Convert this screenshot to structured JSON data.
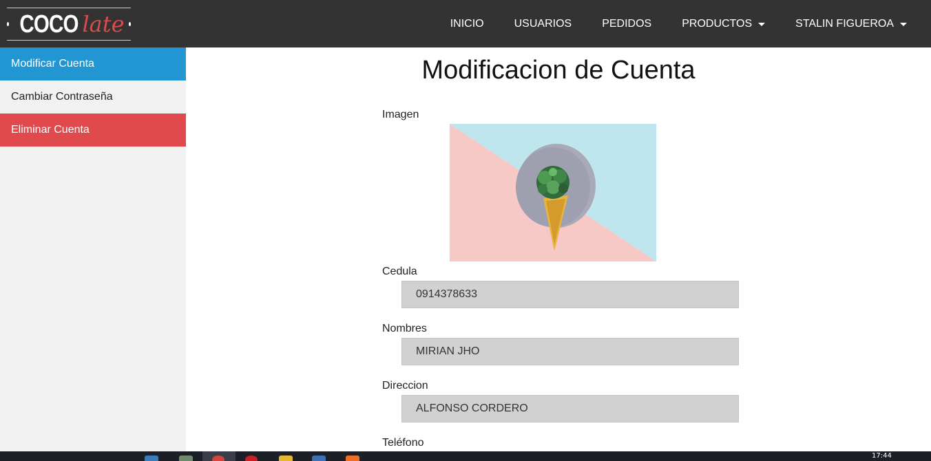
{
  "brand": {
    "part1": "COCO",
    "part2": "late"
  },
  "nav": {
    "links": [
      {
        "label": "INICIO"
      },
      {
        "label": "USUARIOS"
      },
      {
        "label": "PEDIDOS"
      },
      {
        "label": "PRODUCTOS"
      },
      {
        "label": "STALIN FIGUEROA"
      }
    ]
  },
  "sidebar": {
    "items": [
      {
        "label": "Modificar Cuenta"
      },
      {
        "label": "Cambiar Contraseña"
      },
      {
        "label": "Eliminar Cuenta"
      }
    ]
  },
  "main": {
    "title": "Modificacion de Cuenta",
    "image_label": "Imagen",
    "fields": [
      {
        "label": "Cedula",
        "value": "0914378633"
      },
      {
        "label": "Nombres",
        "value": "MIRIAN JHO"
      },
      {
        "label": "Direccion",
        "value": "ALFONSO CORDERO"
      },
      {
        "label": "Teléfono",
        "value": ""
      }
    ]
  },
  "taskbar": {
    "clock": "17:44"
  },
  "colors": {
    "navbar": "#333333",
    "active": "#2196d3",
    "danger": "#e04a4d",
    "field_bg": "#d1d1d1",
    "sidebar_bg": "#f1f1f1"
  }
}
